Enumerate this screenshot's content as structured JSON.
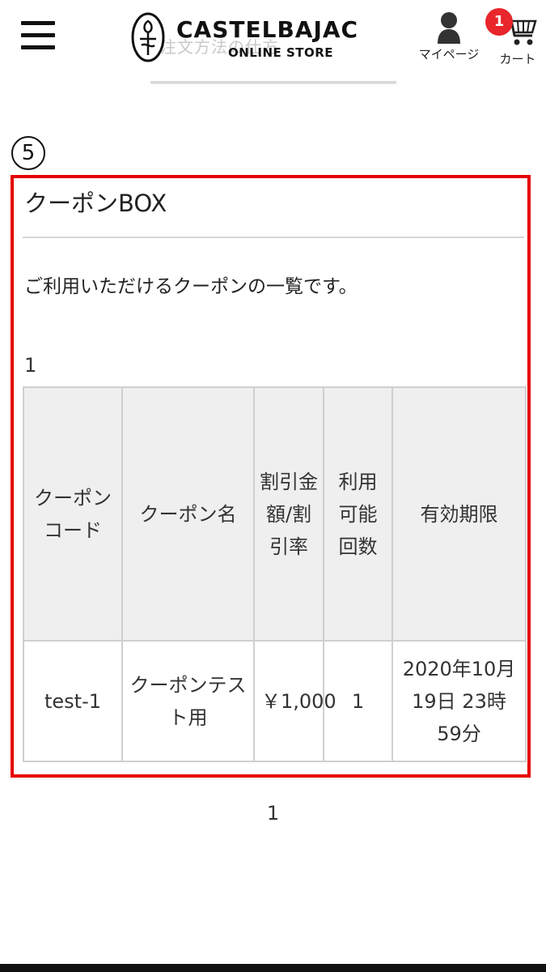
{
  "header": {
    "menu_icon": "hamburger-menu-icon",
    "logo_ghost_text": "注文方法の仕方",
    "brand": "CASTELBAJAC",
    "brand_sub": "ONLINE STORE",
    "mypage_label": "マイページ",
    "mypage_icon": "user-icon",
    "cart_label": "カート",
    "cart_icon": "cart-icon",
    "cart_count": "1",
    "badge_color": "#e8262c"
  },
  "step_marker": "5",
  "highlight_color": "#e60000",
  "main": {
    "title": "クーポンBOX",
    "description": "ご利用いただけるクーポンの一覧です。",
    "count": "1",
    "table": {
      "headers": [
        "クーポンコード",
        "クーポン名",
        "割引金額/割引率",
        "利用可能回数",
        "有効期限"
      ],
      "rows": [
        [
          "test-1",
          "クーポンテスト用",
          "￥1,000",
          "1",
          "2020年10月19日 23時59分"
        ]
      ]
    },
    "pagination": "1"
  }
}
